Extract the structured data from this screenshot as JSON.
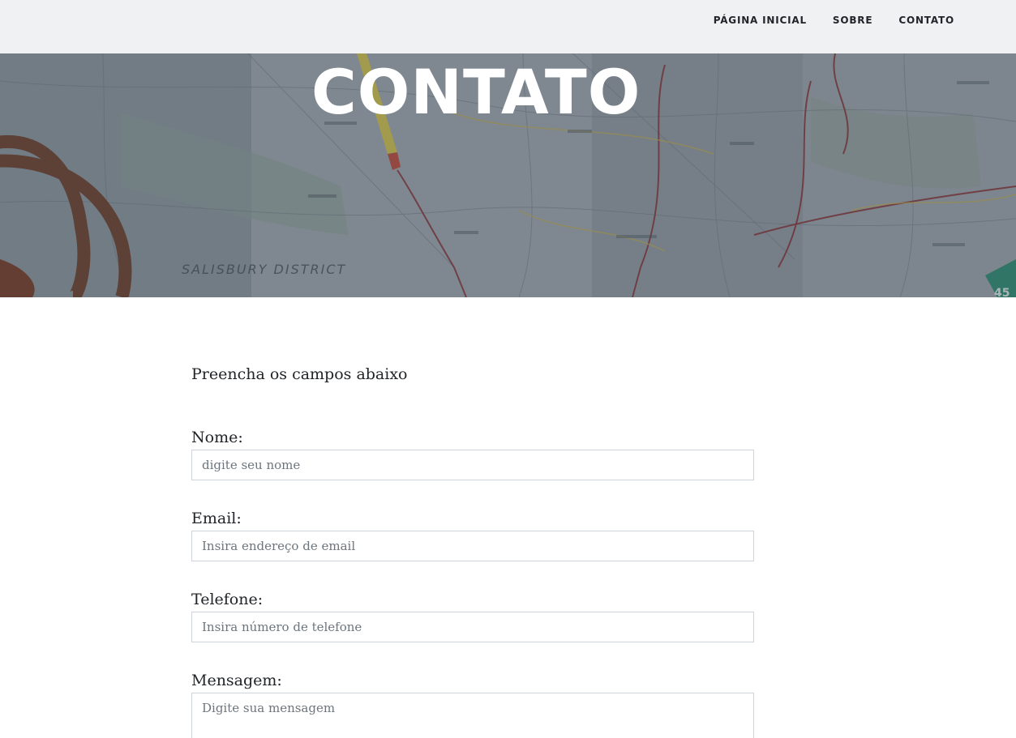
{
  "nav": {
    "items": [
      {
        "label": "PÁGINA INICIAL"
      },
      {
        "label": "SOBRE"
      },
      {
        "label": "CONTATO"
      }
    ]
  },
  "hero": {
    "title": "CONTATO",
    "map_label": "SALISBURY DISTRICT",
    "sign_number": "45"
  },
  "form": {
    "intro": "Preencha os campos abaixo",
    "fields": [
      {
        "label": "Nome:",
        "placeholder": "digite seu nome"
      },
      {
        "label": "Email:",
        "placeholder": "Insira endereço de email"
      },
      {
        "label": "Telefone:",
        "placeholder": "Insira número de telefone"
      },
      {
        "label": "Mensagem:",
        "placeholder": "Digite sua mensagem"
      }
    ]
  },
  "colors": {
    "text": "#212529",
    "input_border": "#ced4da",
    "hero_title": "#ffffff"
  }
}
